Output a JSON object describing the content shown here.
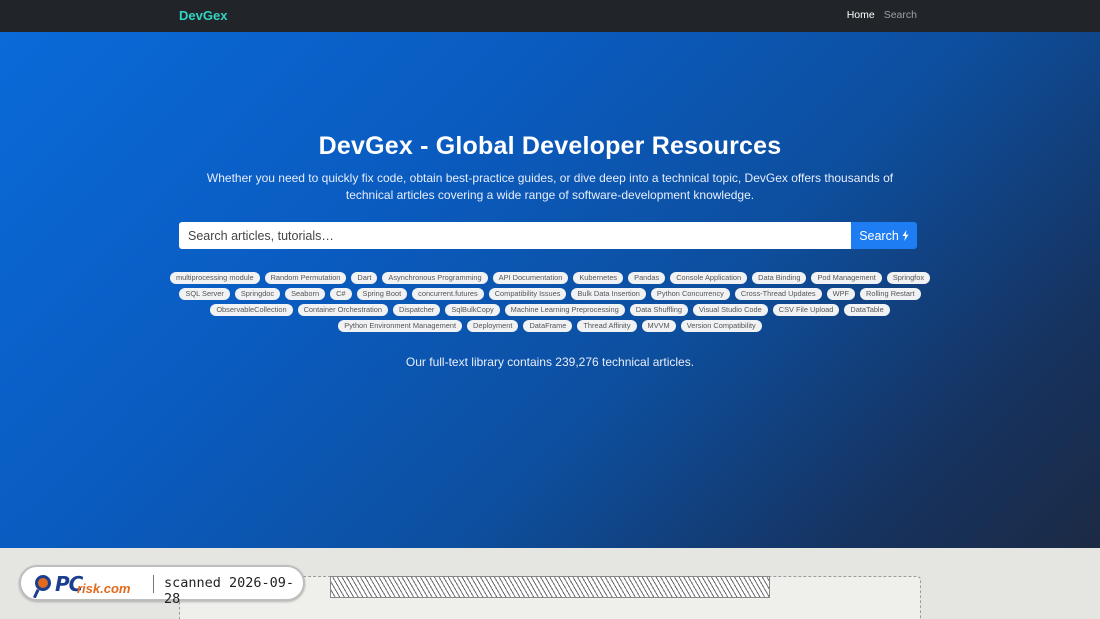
{
  "navbar": {
    "brand": "DevGex",
    "links": [
      {
        "label": "Home",
        "active": true
      },
      {
        "label": "Search",
        "active": false
      }
    ]
  },
  "hero": {
    "title": "DevGex - Global Developer Resources",
    "subtitle": "Whether you need to quickly fix code, obtain best-practice guides, or dive deep into a technical topic, DevGex offers thousands of technical articles covering a wide range of software-development knowledge."
  },
  "search": {
    "placeholder": "Search articles, tutorials…",
    "value": "",
    "button_label": "Search",
    "button_icon": "lightning-bolt-icon"
  },
  "tags": [
    "multiprocessing module",
    "Random Permutation",
    "Dart",
    "Asynchronous Programming",
    "API Documentation",
    "Kubernetes",
    "Pandas",
    "Console Application",
    "Data Binding",
    "Pod Management",
    "Springfox",
    "SQL Server",
    "Springdoc",
    "Seaborn",
    "C#",
    "Spring Boot",
    "concurrent.futures",
    "Compatibility Issues",
    "Bulk Data Insertion",
    "Python Concurrency",
    "Cross-Thread Updates",
    "WPF",
    "Rolling Restart",
    "ObservableCollection",
    "Container Orchestration",
    "Dispatcher",
    "SqlBulkCopy",
    "Machine Learning Preprocessing",
    "Data Shuffling",
    "Visual Studio Code",
    "CSV File Upload",
    "DataTable",
    "Python Environment Management",
    "Deployment",
    "DataFrame",
    "Thread Affinity",
    "MVVM",
    "Version Compatibility"
  ],
  "stats": "Our full-text library contains 239,276 technical articles.",
  "watermark": {
    "brand_main": "PC",
    "brand_suffix": "risk.com",
    "scanned_text": "scanned 2026-09-28",
    "logo_icon": "magnifier-logo-icon"
  },
  "colors": {
    "navbar_bg": "#212529",
    "brand": "#32d3c0",
    "hero_start": "#0a6ad8",
    "hero_end": "#1c2a44",
    "search_button": "#1e7df2"
  }
}
